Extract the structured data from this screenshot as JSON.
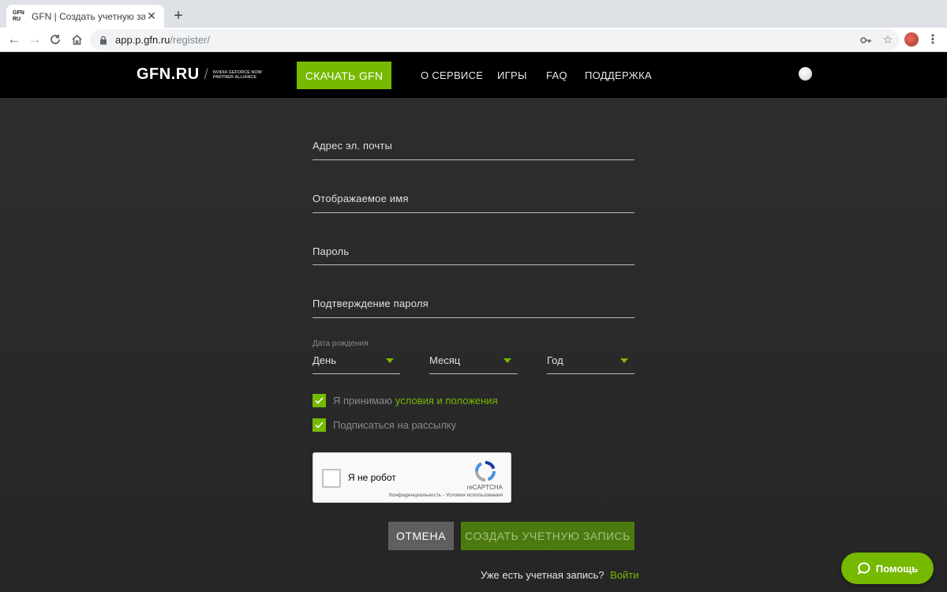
{
  "browser": {
    "tab_title": "GFN | Создать учетную запис",
    "favicon_text": "GFN RU",
    "url_host": "app.p.gfn.ru",
    "url_path": "/register/"
  },
  "header": {
    "logo_text": "GFN.RU",
    "logo_sub": "NVIDIA GEFORCE NOW PARTNER ALLIANCE",
    "download_label": "СКАЧАТЬ GFN",
    "nav": [
      "О СЕРВИСЕ",
      "ИГРЫ",
      "FAQ",
      "ПОДДЕРЖКА"
    ]
  },
  "form": {
    "email_label": "Адрес эл. почты",
    "display_name_label": "Отображаемое имя",
    "password_label": "Пароль",
    "confirm_password_label": "Подтверждение пароля",
    "dob_caption": "Дата рождения",
    "day_value": "День",
    "month_value": "Месяц",
    "year_value": "Год",
    "accept_text": "Я принимаю",
    "accept_link": "условия и положения",
    "accept_checked": true,
    "subscribe_text": "Подписаться на рассылку",
    "subscribe_checked": true
  },
  "recaptcha": {
    "label": "Я не робот",
    "brand": "reCAPTCHA",
    "terms": "Конфиденциальность - Условия использования"
  },
  "actions": {
    "cancel_label": "ОТМЕНА",
    "create_label": "СОЗДАТЬ УЧЕТНУЮ ЗАПИСЬ"
  },
  "footer": {
    "have_account_text": "Уже есть учетная запись?",
    "login_link": "Войти"
  },
  "help": {
    "label": "Помощь"
  },
  "colors": {
    "accent": "#76b900",
    "header_bg": "#000000",
    "page_bg": "#2a2a2a"
  }
}
